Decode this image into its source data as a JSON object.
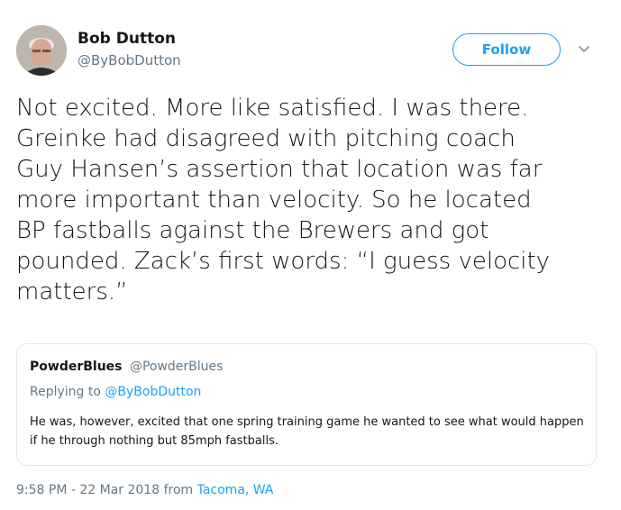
{
  "author": {
    "name": "Bob Dutton",
    "handle": "@ByBobDutton"
  },
  "follow_label": "Follow",
  "icons": {
    "avatar": "profile-photo",
    "more": "chevron-down-icon"
  },
  "tweet": {
    "text": "Not excited. More like satisfied. I was there.\nGreinke had disagreed with pitching coach\nGuy Hansen’s assertion that location was far\nmore important than velocity. So he located\nBP fastballs against the Brewers and got\npounded. Zack’s first words: “I guess velocity\nmatters.”"
  },
  "quoted": {
    "name": "PowderBlues",
    "handle": "@PowderBlues",
    "replying_prefix": "Replying to",
    "replying_to": "@ByBobDutton",
    "text": "He was, however, excited that one spring training game he wanted to see what would happen if he through nothing but 85mph fastballs."
  },
  "footer": {
    "timestamp": "9:58 PM - 22 Mar 2018 from",
    "location": "Tacoma, WA"
  },
  "colors": {
    "accent": "#1da1f2",
    "secondary_text": "#657786",
    "border": "#e1e8ed"
  }
}
